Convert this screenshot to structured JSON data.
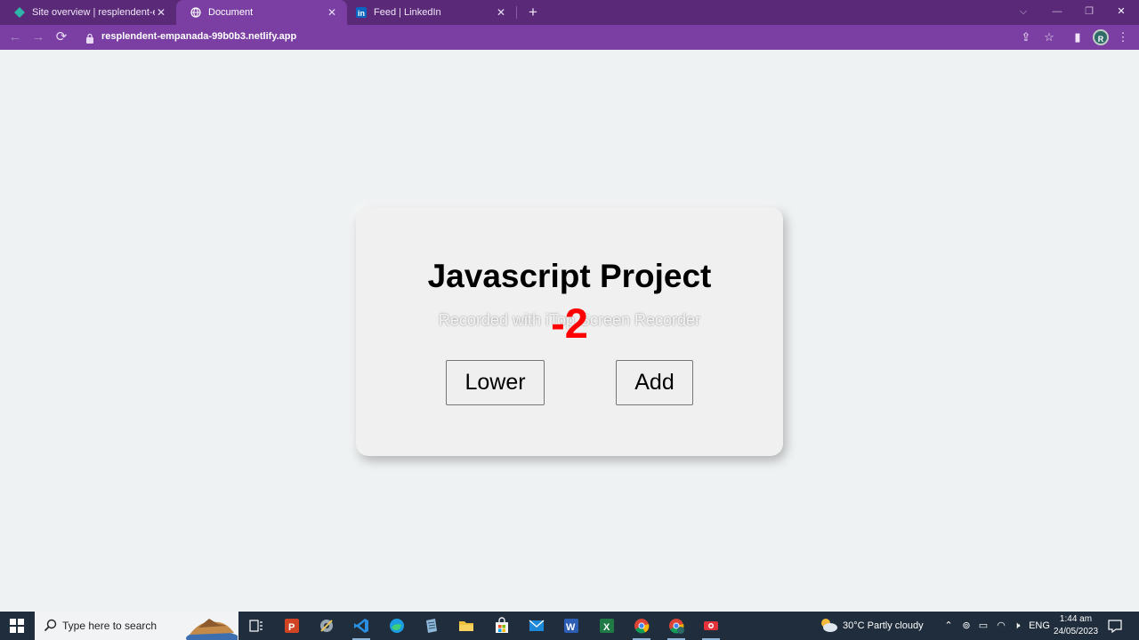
{
  "browser": {
    "tabs": [
      {
        "title": "Site overview | resplendent-empanada",
        "active": false
      },
      {
        "title": "Document",
        "active": true
      },
      {
        "title": "Feed | LinkedIn",
        "active": false
      }
    ],
    "url": "resplendent-empanada-99b0b3.netlify.app",
    "profile_initial": "R"
  },
  "page": {
    "title": "Javascript Project",
    "counter": "-2",
    "lower_label": "Lower",
    "add_label": "Add",
    "watermark": "Recorded with iTop Screen Recorder"
  },
  "taskbar": {
    "search_placeholder": "Type here to search",
    "weather": "30°C  Partly cloudy",
    "language": "ENG",
    "time": "1:44 am",
    "date": "24/05/2023"
  },
  "colors": {
    "tab_strip": "#5a2a78",
    "toolbar": "#7b3fa3",
    "counter": "#ff0000",
    "page_bg": "#eff2f3",
    "taskbar": "#1f2d3c"
  }
}
